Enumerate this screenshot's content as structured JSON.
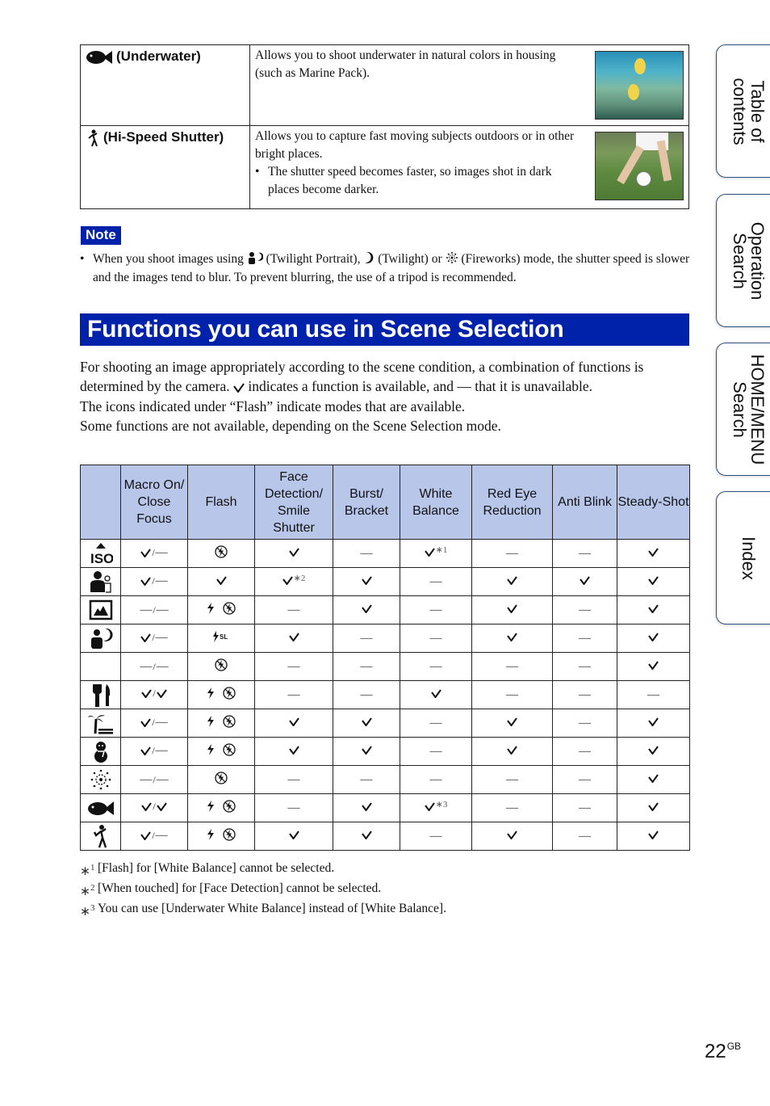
{
  "scene_rows": [
    {
      "icon": "underwater-fish-icon",
      "name": "(Underwater)",
      "description": "Allows you to shoot underwater in natural colors in housing (such as Marine Pack).",
      "bullets": [],
      "thumbnail": "underwater-coral-photo"
    },
    {
      "icon": "hi-speed-shutter-runner-icon",
      "name": "(Hi-Speed Shutter)",
      "description": "Allows you to capture fast moving subjects outdoors or in other bright places.",
      "bullets": [
        "The shutter speed becomes faster, so images shot in dark places become darker."
      ],
      "thumbnail": "soccer-player-photo"
    }
  ],
  "note": {
    "badge": "Note",
    "part1": "When you shoot images using",
    "part2": "(Twilight Portrait),",
    "part3": "(Twilight) or",
    "part4": "(Fireworks) mode, the shutter speed is slower and the images tend to blur. To prevent blurring, the use of a tripod is recommended."
  },
  "section": {
    "title": "Functions you can use in Scene Selection",
    "intro_1a": "For shooting an image appropriately according to the scene condition, a combination of functions is determined by the camera.",
    "intro_1b": "indicates a function is available, and — that it is unavailable.",
    "intro_2": "The icons indicated under “Flash” indicate modes that are available.",
    "intro_3": "Some functions are not available, depending on the Scene Selection mode."
  },
  "table": {
    "headers": [
      "",
      "Macro On/ Close Focus",
      "Flash",
      "Face Detection/ Smile Shutter",
      "Burst/ Bracket",
      "White Balance",
      "Red Eye Reduction",
      "Anti Blink",
      "Steady-Shot"
    ],
    "legend": {
      "check": "✓",
      "dash": "—"
    },
    "rows": [
      {
        "mode": "high-sensitivity-iso",
        "macro": "✓/—",
        "flash": [
          "flash-off"
        ],
        "face": "✓",
        "burst": "—",
        "wb": "✓",
        "wb_note": "1",
        "redeye": "—",
        "blink": "—",
        "steady": "✓"
      },
      {
        "mode": "soft-snap",
        "macro": "✓/—",
        "flash": [
          "check"
        ],
        "face": "✓",
        "face_note": "2",
        "burst": "✓",
        "wb": "—",
        "redeye": "✓",
        "blink": "✓",
        "steady": "✓"
      },
      {
        "mode": "landscape",
        "macro": "—/—",
        "flash": [
          "flash-on",
          "flash-off"
        ],
        "face": "—",
        "burst": "✓",
        "wb": "—",
        "redeye": "✓",
        "blink": "—",
        "steady": "✓"
      },
      {
        "mode": "twilight-portrait",
        "macro": "✓/—",
        "flash": [
          "slow-sync"
        ],
        "face": "✓",
        "burst": "—",
        "wb": "—",
        "redeye": "✓",
        "blink": "—",
        "steady": "✓"
      },
      {
        "mode": "twilight",
        "macro": "—/—",
        "flash": [
          "flash-off"
        ],
        "face": "—",
        "burst": "—",
        "wb": "—",
        "redeye": "—",
        "blink": "—",
        "steady": "✓"
      },
      {
        "mode": "gourmet",
        "macro": "✓/✓",
        "flash": [
          "flash-on",
          "flash-off"
        ],
        "face": "—",
        "burst": "—",
        "wb": "✓",
        "redeye": "—",
        "blink": "—",
        "steady": "—"
      },
      {
        "mode": "beach",
        "macro": "✓/—",
        "flash": [
          "flash-on",
          "flash-off"
        ],
        "face": "✓",
        "burst": "✓",
        "wb": "—",
        "redeye": "✓",
        "blink": "—",
        "steady": "✓"
      },
      {
        "mode": "snow",
        "macro": "✓/—",
        "flash": [
          "flash-on",
          "flash-off"
        ],
        "face": "✓",
        "burst": "✓",
        "wb": "—",
        "redeye": "✓",
        "blink": "—",
        "steady": "✓"
      },
      {
        "mode": "fireworks",
        "macro": "—/—",
        "flash": [
          "flash-off"
        ],
        "face": "—",
        "burst": "—",
        "wb": "—",
        "redeye": "—",
        "blink": "—",
        "steady": "✓"
      },
      {
        "mode": "underwater",
        "macro": "✓/✓",
        "flash": [
          "flash-on",
          "flash-off"
        ],
        "face": "—",
        "burst": "✓",
        "wb": "✓",
        "wb_note": "3",
        "redeye": "—",
        "blink": "—",
        "steady": "✓"
      },
      {
        "mode": "hi-speed-shutter",
        "macro": "✓/—",
        "flash": [
          "flash-on",
          "flash-off"
        ],
        "face": "✓",
        "burst": "✓",
        "wb": "—",
        "redeye": "✓",
        "blink": "—",
        "steady": "✓"
      }
    ]
  },
  "footnotes": [
    {
      "mark": "1",
      "text": "[Flash] for [White Balance] cannot be selected."
    },
    {
      "mark": "2",
      "text": "[When touched] for [Face Detection] cannot be selected."
    },
    {
      "mark": "3",
      "text": "You can use [Underwater White Balance] instead of [White Balance]."
    }
  ],
  "side_tabs": [
    {
      "line1": "Table of",
      "line2": "contents"
    },
    {
      "line1": "Operation",
      "line2": "Search"
    },
    {
      "line1": "HOME/MENU",
      "line2": "Search"
    },
    {
      "line1": "Index",
      "line2": ""
    }
  ],
  "page": {
    "number": "22",
    "suffix": "GB"
  },
  "colors": {
    "heading_bg": "#0022aa",
    "table_header_bg": "#b8c6ea",
    "tab_border": "#2e4f7a"
  }
}
